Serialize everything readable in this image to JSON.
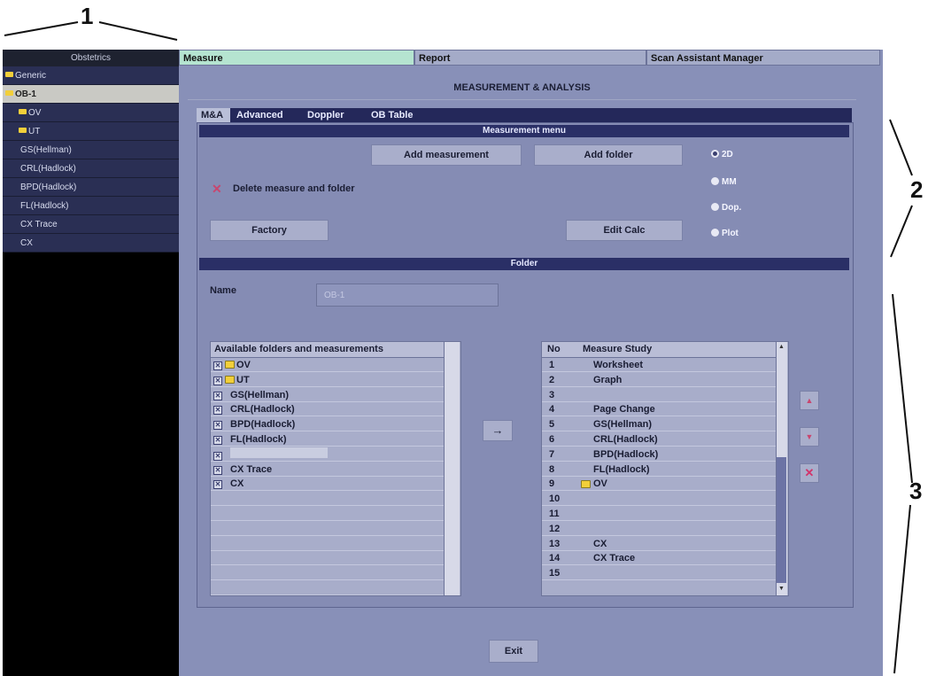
{
  "callouts": {
    "one": "1",
    "two": "2",
    "three": "3"
  },
  "left_panel": {
    "header": "Obstetrics",
    "items": [
      {
        "label": "Generic",
        "folder": true,
        "selected": false
      },
      {
        "label": "OB-1",
        "folder": true,
        "selected": true
      },
      {
        "label": "OV",
        "folder": true,
        "selected": false
      },
      {
        "label": "UT",
        "folder": true,
        "selected": false
      },
      {
        "label": "GS(Hellman)",
        "folder": false,
        "selected": false
      },
      {
        "label": "CRL(Hadlock)",
        "folder": false,
        "selected": false
      },
      {
        "label": "BPD(Hadlock)",
        "folder": false,
        "selected": false
      },
      {
        "label": "FL(Hadlock)",
        "folder": false,
        "selected": false
      },
      {
        "label": "CX Trace",
        "folder": false,
        "selected": false
      },
      {
        "label": "CX",
        "folder": false,
        "selected": false
      }
    ]
  },
  "top_tabs": [
    {
      "label": "Measure",
      "active": true
    },
    {
      "label": "Report",
      "active": false
    },
    {
      "label": "Scan Assistant Manager",
      "active": false
    }
  ],
  "title": "MEASUREMENT & ANALYSIS",
  "sub_tabs": [
    {
      "label": "M&A",
      "active": true
    },
    {
      "label": "Advanced",
      "active": false
    },
    {
      "label": "Doppler",
      "active": false
    },
    {
      "label": "OB Table",
      "active": false
    }
  ],
  "measurement_menu": {
    "title": "Measurement menu",
    "add_measurement": "Add measurement",
    "add_folder": "Add folder",
    "delete_label": "Delete measure and folder",
    "factory": "Factory",
    "edit_calc": "Edit Calc",
    "modes": [
      {
        "label": "2D",
        "selected": true
      },
      {
        "label": "MM",
        "selected": false
      },
      {
        "label": "Dop.",
        "selected": false
      },
      {
        "label": "Plot",
        "selected": false
      }
    ]
  },
  "folder_section": {
    "title": "Folder",
    "name_label": "Name",
    "name_value": "OB-1",
    "available_header": "Available folders and measurements",
    "available": [
      {
        "label": "OV",
        "folder": true,
        "indent": 0,
        "dim": false
      },
      {
        "label": "UT",
        "folder": true,
        "indent": 0,
        "dim": false
      },
      {
        "label": "GS(Hellman)",
        "folder": false,
        "indent": 1,
        "dim": false
      },
      {
        "label": "CRL(Hadlock)",
        "folder": false,
        "indent": 1,
        "dim": false
      },
      {
        "label": "BPD(Hadlock)",
        "folder": false,
        "indent": 1,
        "dim": false
      },
      {
        "label": "FL(Hadlock)",
        "folder": false,
        "indent": 1,
        "dim": false
      },
      {
        "label": "",
        "folder": false,
        "indent": 1,
        "dim": true
      },
      {
        "label": "CX Trace",
        "folder": false,
        "indent": 1,
        "dim": false
      },
      {
        "label": "CX",
        "folder": false,
        "indent": 1,
        "dim": false
      }
    ],
    "transfer_button": "→",
    "study_header_no": "No",
    "study_header_name": "Measure  Study",
    "study": [
      {
        "no": "1",
        "name": "Worksheet",
        "folder": false
      },
      {
        "no": "2",
        "name": "Graph",
        "folder": false
      },
      {
        "no": "3",
        "name": "",
        "folder": false
      },
      {
        "no": "4",
        "name": "Page Change",
        "folder": false
      },
      {
        "no": "5",
        "name": "GS(Hellman)",
        "folder": false
      },
      {
        "no": "6",
        "name": "CRL(Hadlock)",
        "folder": false
      },
      {
        "no": "7",
        "name": "BPD(Hadlock)",
        "folder": false
      },
      {
        "no": "8",
        "name": "FL(Hadlock)",
        "folder": false
      },
      {
        "no": "9",
        "name": "OV",
        "folder": true
      },
      {
        "no": "10",
        "name": "",
        "folder": false
      },
      {
        "no": "11",
        "name": "",
        "folder": false
      },
      {
        "no": "12",
        "name": "",
        "folder": false
      },
      {
        "no": "13",
        "name": "CX",
        "folder": false
      },
      {
        "no": "14",
        "name": "CX Trace",
        "folder": false
      },
      {
        "no": "15",
        "name": "",
        "folder": false
      }
    ]
  },
  "exit_label": "Exit",
  "colors": {
    "panel": "#8890b8",
    "section_bar": "#2a2f66",
    "active_tab": "#b5e4d0",
    "left_bg": "#000000"
  }
}
